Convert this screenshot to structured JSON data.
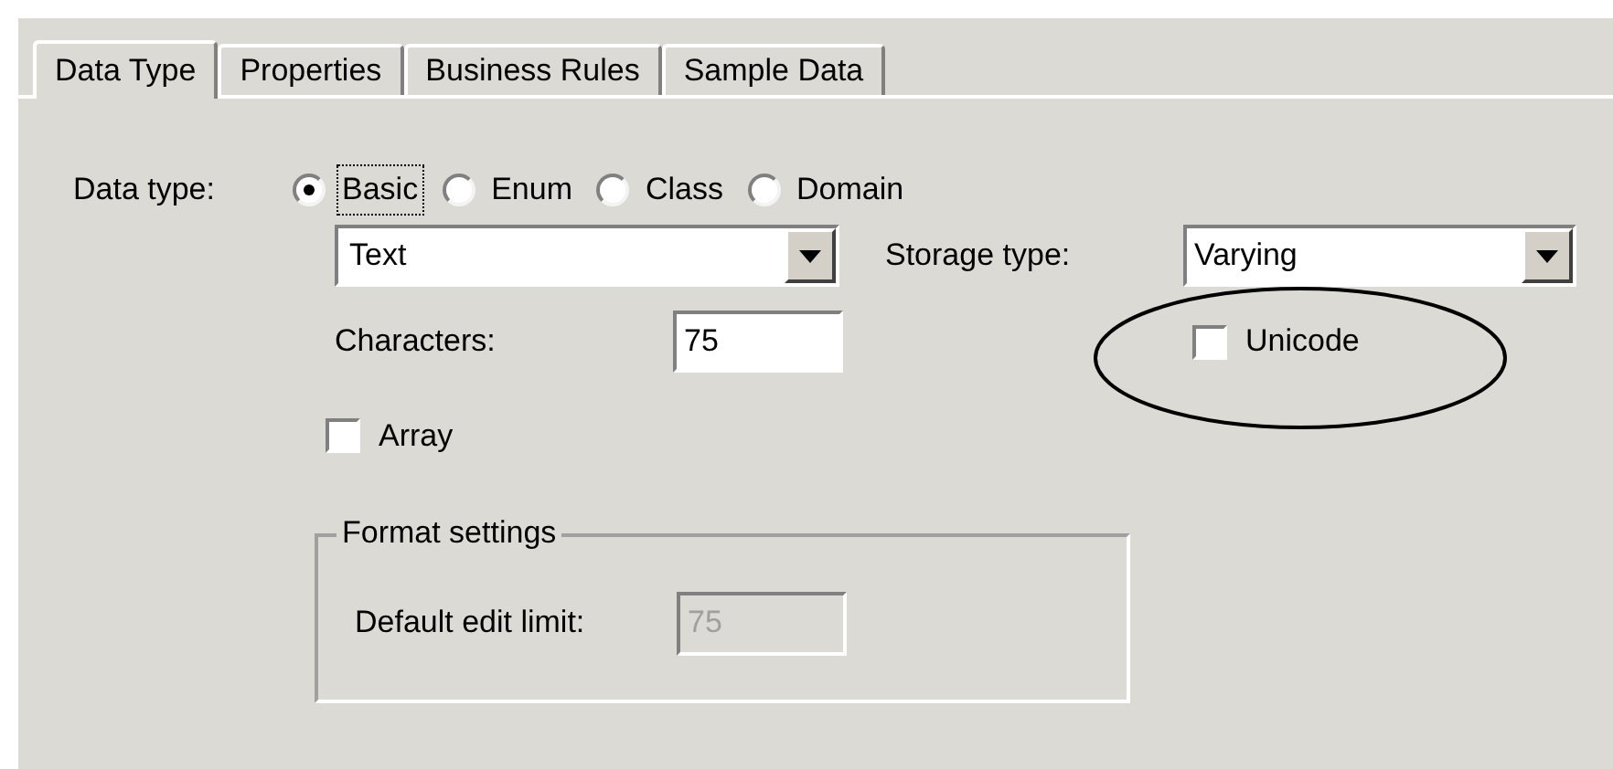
{
  "tabs": [
    {
      "label": "Data Type",
      "selected": true
    },
    {
      "label": "Properties",
      "selected": false
    },
    {
      "label": "Business Rules",
      "selected": false
    },
    {
      "label": "Sample Data",
      "selected": false
    }
  ],
  "data_type": {
    "label": "Data type:",
    "options": [
      {
        "label": "Basic",
        "selected": true,
        "focused": true
      },
      {
        "label": "Enum",
        "selected": false,
        "focused": false
      },
      {
        "label": "Class",
        "selected": false,
        "focused": false
      },
      {
        "label": "Domain",
        "selected": false,
        "focused": false
      }
    ]
  },
  "type_dropdown": {
    "value": "Text"
  },
  "storage_type": {
    "label": "Storage type:",
    "value": "Varying"
  },
  "characters": {
    "label": "Characters:",
    "value": "75"
  },
  "unicode": {
    "label": "Unicode",
    "checked": false
  },
  "array": {
    "label": "Array",
    "checked": false
  },
  "format_settings": {
    "title": "Format settings",
    "default_edit_limit": {
      "label": "Default edit limit:",
      "value": "75",
      "disabled": true
    }
  }
}
